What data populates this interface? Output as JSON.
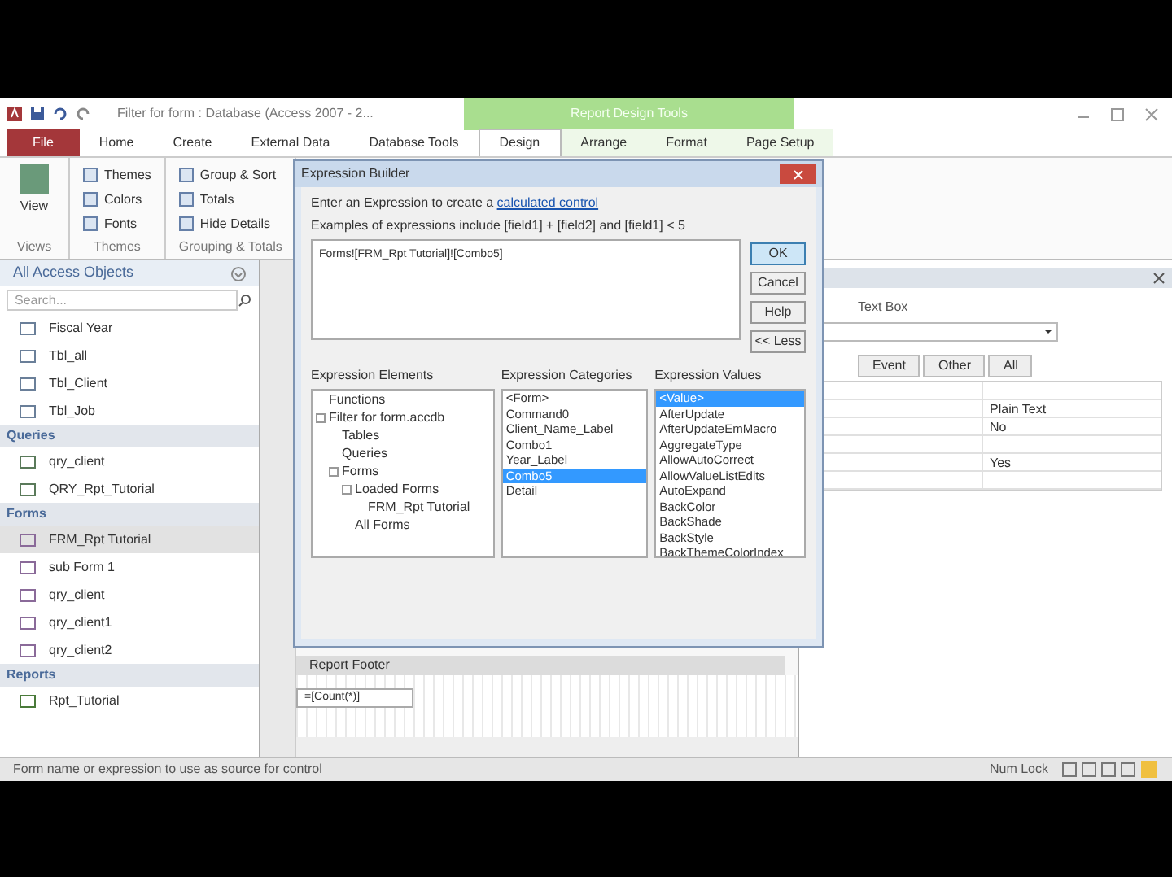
{
  "window": {
    "title": "Filter for form : Database (Access 2007 - 2..."
  },
  "contextual_group": {
    "title": "Report Design Tools"
  },
  "ribbon_tabs": [
    {
      "label": "File",
      "kind": "file",
      "selected": false
    },
    {
      "label": "Home",
      "kind": "tab",
      "selected": false
    },
    {
      "label": "Create",
      "kind": "tab",
      "selected": false
    },
    {
      "label": "External Data",
      "kind": "tab",
      "selected": false
    },
    {
      "label": "Database Tools",
      "kind": "tab",
      "selected": false
    },
    {
      "label": "Design",
      "kind": "context",
      "selected": true
    },
    {
      "label": "Arrange",
      "kind": "context",
      "selected": false
    },
    {
      "label": "Format",
      "kind": "context",
      "selected": false
    },
    {
      "label": "Page Setup",
      "kind": "context",
      "selected": false
    }
  ],
  "ribbon_groups": [
    {
      "label": "Views",
      "buttons": [
        {
          "label": "View",
          "kind": "large"
        }
      ]
    },
    {
      "label": "Themes",
      "buttons": [
        {
          "label": "Themes",
          "kind": "small"
        },
        {
          "label": "Colors",
          "kind": "small"
        },
        {
          "label": "Fonts",
          "kind": "small"
        }
      ]
    },
    {
      "label": "Grouping & Totals",
      "buttons": [
        {
          "label": "Group & Sort",
          "kind": "small"
        },
        {
          "label": "Totals",
          "kind": "small"
        },
        {
          "label": "Hide Details",
          "kind": "small"
        }
      ]
    }
  ],
  "nav_pane": {
    "title": "All Access Objects",
    "search": {
      "placeholder": "Search..."
    },
    "sections": [
      {
        "kind": "table",
        "items": [
          {
            "label": "Fiscal Year",
            "selected": false
          },
          {
            "label": "Tbl_all",
            "selected": false
          },
          {
            "label": "Tbl_Client",
            "selected": false
          },
          {
            "label": "Tbl_Job",
            "selected": false
          }
        ]
      },
      {
        "title": "Queries",
        "kind": "query",
        "items": [
          {
            "label": "qry_client",
            "selected": false
          },
          {
            "label": "QRY_Rpt_Tutorial",
            "selected": false
          }
        ]
      },
      {
        "title": "Forms",
        "kind": "form",
        "items": [
          {
            "label": "FRM_Rpt Tutorial",
            "selected": true
          },
          {
            "label": "sub Form 1",
            "selected": false
          },
          {
            "label": "qry_client",
            "selected": false
          },
          {
            "label": "qry_client1",
            "selected": false
          },
          {
            "label": "qry_client2",
            "selected": false
          }
        ]
      },
      {
        "title": "Reports",
        "kind": "report",
        "items": [
          {
            "label": "Rpt_Tutorial",
            "selected": false
          }
        ]
      }
    ]
  },
  "report_design": {
    "band": "Report Footer",
    "control": "=[Count(*)]"
  },
  "property_sheet": {
    "selection_type": "Text Box",
    "tabs": [
      {
        "label": "Event",
        "selected": false
      },
      {
        "label": "Other",
        "selected": false
      },
      {
        "label": "All",
        "selected": false
      }
    ],
    "rows": [
      {
        "value": ""
      },
      {
        "value": "Plain Text"
      },
      {
        "value": "No"
      },
      {
        "value": ""
      },
      {
        "value": "Yes"
      },
      {
        "value": ""
      }
    ]
  },
  "dialog": {
    "title": "Expression Builder",
    "intro": "Enter an Expression to create a",
    "intro_link": "calculated control",
    "examples": "Examples of expressions include [field1] + [field2] and [field1] < 5",
    "expression": "Forms![FRM_Rpt Tutorial]![Combo5]",
    "buttons": [
      {
        "label": "OK",
        "selected": true
      },
      {
        "label": "Cancel",
        "selected": false
      },
      {
        "label": "Help",
        "selected": false
      },
      {
        "label": "<< Less",
        "selected": false
      }
    ],
    "elements": {
      "title": "Expression Elements",
      "items": [
        {
          "label": "Functions"
        },
        {
          "label": "Filter for form.accdb",
          "children": [
            {
              "label": "Tables"
            },
            {
              "label": "Queries"
            },
            {
              "label": "Forms",
              "children": [
                {
                  "label": "Loaded Forms",
                  "children": [
                    {
                      "label": "FRM_Rpt Tutorial"
                    }
                  ]
                },
                {
                  "label": "All Forms"
                }
              ]
            }
          ]
        }
      ]
    },
    "categories": {
      "title": "Expression Categories",
      "items": [
        {
          "label": "<Form>",
          "selected": false
        },
        {
          "label": "Command0",
          "selected": false
        },
        {
          "label": "Client_Name_Label",
          "selected": false
        },
        {
          "label": "Combo1",
          "selected": false
        },
        {
          "label": "Year_Label",
          "selected": false
        },
        {
          "label": "Combo5",
          "selected": true
        },
        {
          "label": "Detail",
          "selected": false
        }
      ]
    },
    "values": {
      "title": "Expression Values",
      "items": [
        {
          "label": "<Value>",
          "selected": true
        },
        {
          "label": "AfterUpdate",
          "selected": false
        },
        {
          "label": "AfterUpdateEmMacro",
          "selected": false
        },
        {
          "label": "AggregateType",
          "selected": false
        },
        {
          "label": "AllowAutoCorrect",
          "selected": false
        },
        {
          "label": "AllowValueListEdits",
          "selected": false
        },
        {
          "label": "AutoExpand",
          "selected": false
        },
        {
          "label": "BackColor",
          "selected": false
        },
        {
          "label": "BackShade",
          "selected": false
        },
        {
          "label": "BackStyle",
          "selected": false
        },
        {
          "label": "BackThemeColorIndex",
          "selected": false
        }
      ]
    }
  },
  "status_bar": {
    "text": "Form name or expression to use as source for control",
    "mode": "Num Lock"
  }
}
